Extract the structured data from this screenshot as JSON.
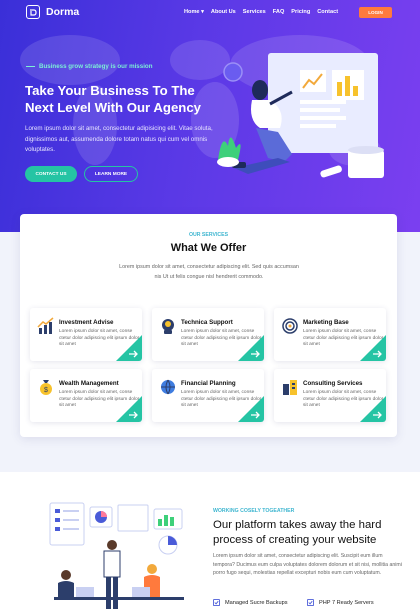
{
  "brand": {
    "name": "Dorma"
  },
  "nav": {
    "items": [
      {
        "label": "Home ▾"
      },
      {
        "label": "About Us"
      },
      {
        "label": "Services"
      },
      {
        "label": "FAQ"
      },
      {
        "label": "Pricing"
      },
      {
        "label": "Contact"
      }
    ],
    "login_label": "LOGIN"
  },
  "hero": {
    "tagline": "Business grow strategy is our mission",
    "title": "Take Your Business To The Next Level With Our Agency",
    "description": "Lorem ipsum dolor sit amet, consectetur adipisicing elit. Vitae soluta, dignissimos aut, assumenda dolore totam natus qui cum vel omnis voluptates.",
    "contact_label": "CONTACT US",
    "learn_label": "LEARN MORE"
  },
  "offer": {
    "eyebrow": "OUR SERVICES",
    "title": "What We Offer",
    "description": "Lorem ipsum dolor sit amet, consectetur adipiscing elit. Sed quis accumsan nis Ut ut felis congue nisl hendrerit commodo.",
    "services": [
      {
        "title": "Investment Advise",
        "desc": "Lorem ipsum dolor sit amet, conse ctetur dolor adipiscing elit ipsum dolor sit amet",
        "icon": "chart-icon"
      },
      {
        "title": "Technica Support",
        "desc": "Lorem ipsum dolor sit amet, conse ctetur dolor adipiscing elit ipsum dolor sit amet",
        "icon": "support-icon"
      },
      {
        "title": "Marketing Base",
        "desc": "Lorem ipsum dolor sit amet, conse ctetur dolor adipiscing elit ipsum dolor sit amet",
        "icon": "target-icon"
      },
      {
        "title": "Wealth Management",
        "desc": "Lorem ipsum dolor sit amet, conse ctetur dolor adipiscing elit ipsum dolor sit amet",
        "icon": "money-bag-icon"
      },
      {
        "title": "Financial Planning",
        "desc": "Lorem ipsum dolor sit amet, conse ctetur dolor adipiscing elit ipsum dolor sit amet",
        "icon": "globe-icon"
      },
      {
        "title": "Consulting Services",
        "desc": "Lorem ipsum dolor sit amet, conse ctetur dolor adipiscing elit ipsum dolor sit amet",
        "icon": "building-icon"
      }
    ]
  },
  "platform": {
    "eyebrow": "WORKING COSELY TOGEATHER",
    "title": "Our platform takes away the hard process of creating your website",
    "description": "Lorem ipsum dolor sit amet, consectetur adipiscing elit. Suscipit eum illum tempora? Ducimus eum culpa voluptates dolorem dolorum et sit nisi, mollitia animi porro fugo sequi, molestias repellat excepturi nobis eum cum voluptatum.",
    "checks": [
      {
        "label": "Managed Sucre Backups"
      },
      {
        "label": "PHP 7 Ready Servers"
      }
    ]
  },
  "colors": {
    "hero_start": "#3a2fd8",
    "hero_end": "#7b3ff0",
    "accent_teal": "#25c4a4",
    "login_orange": "#ff7a3d",
    "eyebrow_blue": "#3fb6d0"
  }
}
